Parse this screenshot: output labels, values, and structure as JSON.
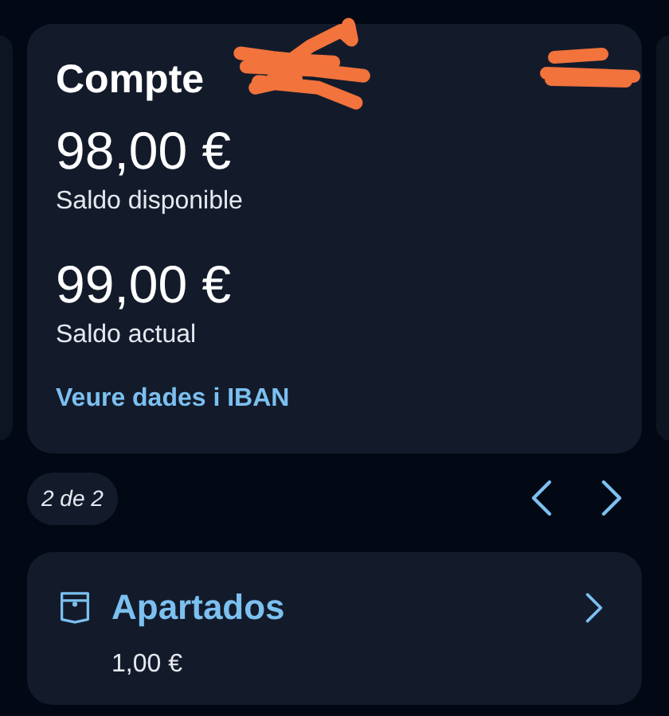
{
  "account": {
    "title": "Compte",
    "balances": [
      {
        "amount": "98,00 €",
        "label": "Saldo disponible"
      },
      {
        "amount": "99,00 €",
        "label": "Saldo actual"
      }
    ],
    "link": "Veure dades i IBAN"
  },
  "pager": {
    "counter": "2 de 2"
  },
  "savings": {
    "title": "Apartados",
    "amount": "1,00 €"
  }
}
